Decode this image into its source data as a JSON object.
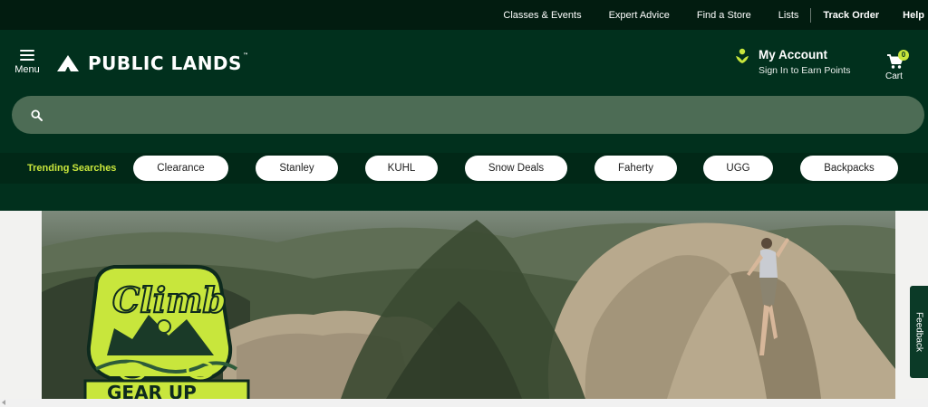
{
  "utility_nav": {
    "links": [
      "Classes & Events",
      "Expert Advice",
      "Find a Store",
      "Lists"
    ],
    "track_order": "Track Order",
    "help": "Help"
  },
  "header": {
    "menu_label": "Menu",
    "logo_text": "PUBLIC LANDS",
    "logo_tm": "™",
    "account_title": "My Account",
    "account_subtitle": "Sign In to Earn Points",
    "cart_label": "Cart",
    "cart_count": "0"
  },
  "search": {
    "placeholder": "",
    "value": ""
  },
  "trending": {
    "label": "Trending Searches",
    "chips": [
      "Clearance",
      "Stanley",
      "KUHL",
      "Snow Deals",
      "Faherty",
      "UGG",
      "Backpacks"
    ]
  },
  "hero": {
    "badge_line1": "Climb",
    "badge_line2": "GEAR UP"
  },
  "feedback": {
    "label": "Feedback"
  },
  "colors": {
    "utility_bg": "#021c10",
    "header_bg": "#01301d",
    "search_bg": "#4d6c55",
    "accent_lime": "#c8e63c"
  }
}
